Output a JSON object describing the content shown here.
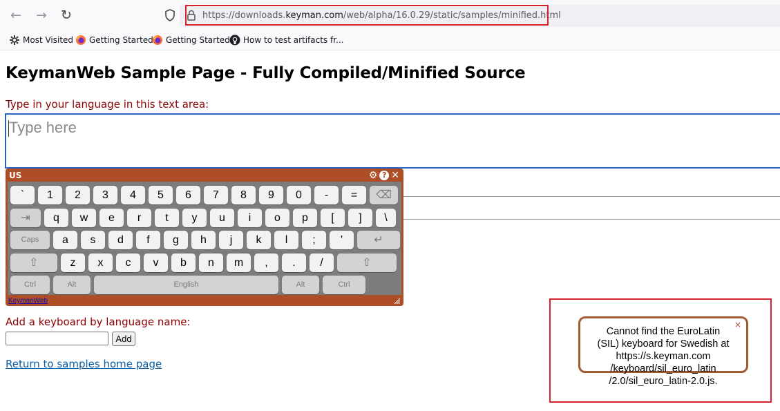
{
  "browser": {
    "url_prefix": "https://downloads.",
    "url_domain": "keyman.com",
    "url_path": "/web/alpha/16.0.29/static/samples/minified.html",
    "bookmarks": [
      {
        "label": "Most Visited",
        "icon": "gear-icon"
      },
      {
        "label": "Getting Started",
        "icon": "firefox-icon"
      },
      {
        "label": "Getting Started",
        "icon": "firefox-icon"
      },
      {
        "label": "How to test artifacts fr...",
        "icon": "github-icon"
      }
    ]
  },
  "page": {
    "title": "KeymanWeb Sample Page - Fully Compiled/Minified Source",
    "textarea_label": "Type in your language in this text area:",
    "textarea_placeholder": "Type here",
    "add_label": "Add a keyboard by language name:",
    "add_button": "Add",
    "return_link": "Return to samples home page"
  },
  "osk": {
    "title": "US",
    "footer_link": "KeymanWeb",
    "rows": [
      [
        "`",
        "1",
        "2",
        "3",
        "4",
        "5",
        "6",
        "7",
        "8",
        "9",
        "0",
        "-",
        "=",
        "bksp"
      ],
      [
        "tab",
        "q",
        "w",
        "e",
        "r",
        "t",
        "y",
        "u",
        "i",
        "o",
        "p",
        "[",
        "]",
        "\\"
      ],
      [
        "Caps",
        "a",
        "s",
        "d",
        "f",
        "g",
        "h",
        "j",
        "k",
        "l",
        ";",
        "'",
        "enter"
      ],
      [
        "shift",
        "z",
        "x",
        "c",
        "v",
        "b",
        "n",
        "m",
        ",",
        ".",
        "/",
        "shift"
      ],
      [
        "Ctrl",
        "Alt",
        "English",
        "Alt",
        "Ctrl"
      ]
    ]
  },
  "alert": {
    "lines": [
      "Cannot find the EuroLatin",
      "(SIL) keyboard for Swedish at",
      "https://s.keyman.com",
      "/keyboard/sil_euro_latin",
      "/2.0/sil_euro_latin-2.0.js."
    ],
    "close": "×"
  },
  "colors": {
    "osk_bg": "#ad4e26",
    "label_red": "#8b0000",
    "highlight_red": "#d8232a",
    "link_blue": "#0b5fa8"
  }
}
